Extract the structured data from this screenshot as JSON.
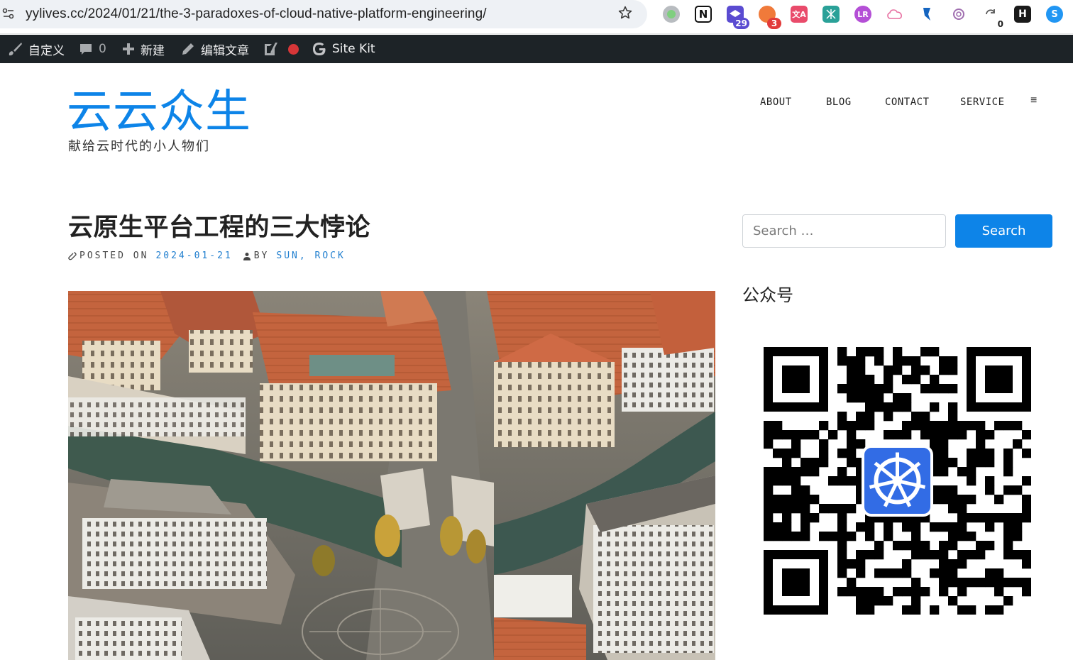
{
  "browser": {
    "url": "yylives.cc/2024/01/21/the-3-paradoxes-of-cloud-native-platform-engineering/",
    "extensions": [
      {
        "name": "circle-extension-icon",
        "badge": ""
      },
      {
        "name": "notion-extension-icon",
        "badge": ""
      },
      {
        "name": "calendar-extension-icon",
        "badge": "29"
      },
      {
        "name": "tabs-extension-icon",
        "badge": "3"
      },
      {
        "name": "translate-extension-icon",
        "badge": ""
      },
      {
        "name": "pattern-extension-icon",
        "badge": ""
      },
      {
        "name": "chat-extension-icon",
        "badge": ""
      },
      {
        "name": "cloud-extension-icon",
        "badge": ""
      },
      {
        "name": "bookmark-extension-icon",
        "badge": ""
      },
      {
        "name": "openai-extension-icon",
        "badge": ""
      },
      {
        "name": "sync-extension-icon",
        "badge": "0"
      },
      {
        "name": "h-extension-icon",
        "badge": ""
      },
      {
        "name": "blue-extension-icon",
        "badge": ""
      }
    ]
  },
  "adminbar": {
    "customize": "自定义",
    "comments_count": "0",
    "new": "新建",
    "edit_post": "编辑文章",
    "site_kit": "Site Kit"
  },
  "site": {
    "title": "云云众生",
    "tagline": "献给云时代的小人物们",
    "nav": [
      "ABOUT",
      "BLOG",
      "CONTACT",
      "SERVICE"
    ],
    "nav_toggle": "≡"
  },
  "post": {
    "title": "云原生平台工程的三大悖论",
    "posted_on_label": "POSTED ON",
    "date": "2024-01-21",
    "by_label": "BY",
    "authors": "SUN, ROCK"
  },
  "sidebar": {
    "search_placeholder": "Search …",
    "search_button": "Search",
    "widget_title": "公众号"
  },
  "colors": {
    "accent": "#0d84e8",
    "adminbar_bg": "#1d2327",
    "link": "#1f7ecf"
  }
}
